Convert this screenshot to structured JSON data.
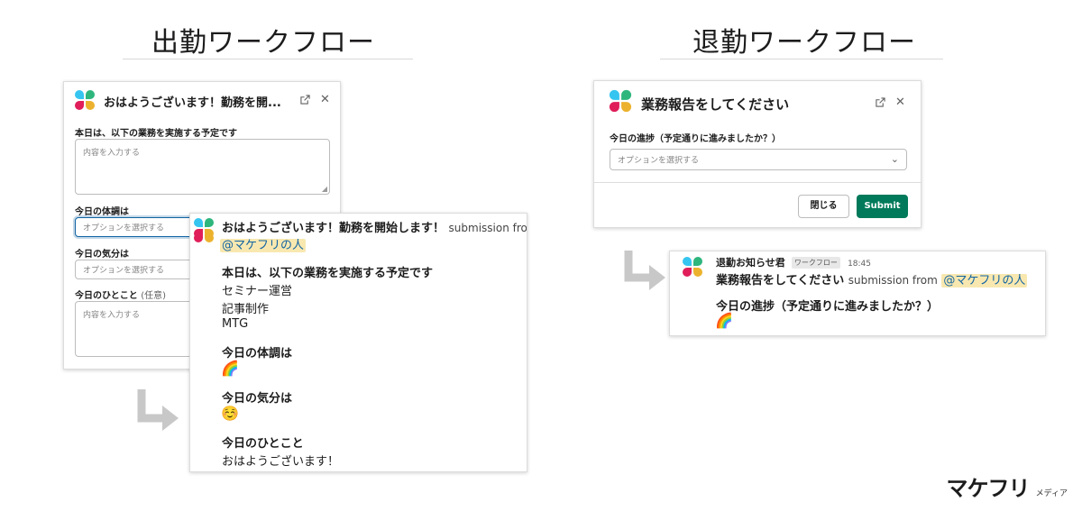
{
  "clock_in": {
    "title": "出勤ワークフロー",
    "modal": {
      "title": "おはようございます！勤務を開...",
      "field1_label": "本日は、以下の業務を実施する予定です",
      "field1_placeholder": "内容を入力する",
      "field2_label": "今日の体調は",
      "field2_placeholder": "オプションを選択する",
      "field3_label": "今日の気分は",
      "field3_placeholder": "オプションを選択する",
      "field4_label": "今日のひとこと",
      "field4_optional": "(任意)",
      "field4_placeholder": "内容を入力する"
    },
    "message": {
      "title": "おはようございます！勤務を開始します！",
      "submission_from": "submission from",
      "mention": "@マケフリの人",
      "q1": "本日は、以下の業務を実施する予定です",
      "a1_lines": [
        "セミナー運営",
        "記事制作",
        "MTG"
      ],
      "q2": "今日の体調は",
      "a2_emoji": "🌈",
      "q3": "今日の気分は",
      "a3_emoji": "☺️",
      "q4": "今日のひとこと",
      "a4": "おはようございます！"
    }
  },
  "clock_out": {
    "title": "退勤ワークフロー",
    "modal": {
      "title": "業務報告をしてください",
      "field_label": "今日の進捗（予定通りに進みましたか？）",
      "field_placeholder": "オプションを選択する",
      "cancel_label": "閉じる",
      "submit_label": "Submit"
    },
    "message": {
      "bot_name": "退勤お知らせ君",
      "badge": "ワークフロー",
      "time": "18:45",
      "title": "業務報告をしてください",
      "submission_from": "submission from",
      "mention": "@マケフリの人",
      "q1": "今日の進捗（予定通りに進みましたか？）",
      "a1_emoji": "🌈"
    }
  },
  "icons": {
    "external": "external-link-icon",
    "close": "close-icon",
    "chevron": "chevron-down-icon",
    "arrow": "down-right-arrow-icon"
  },
  "colors": {
    "submit": "#007a5a",
    "mention_bg": "#f8e8b0",
    "mention_text": "#1264a3",
    "arrow": "#c8c8c8"
  },
  "brand": {
    "logo": "マケフリ",
    "sub": "メディア"
  }
}
